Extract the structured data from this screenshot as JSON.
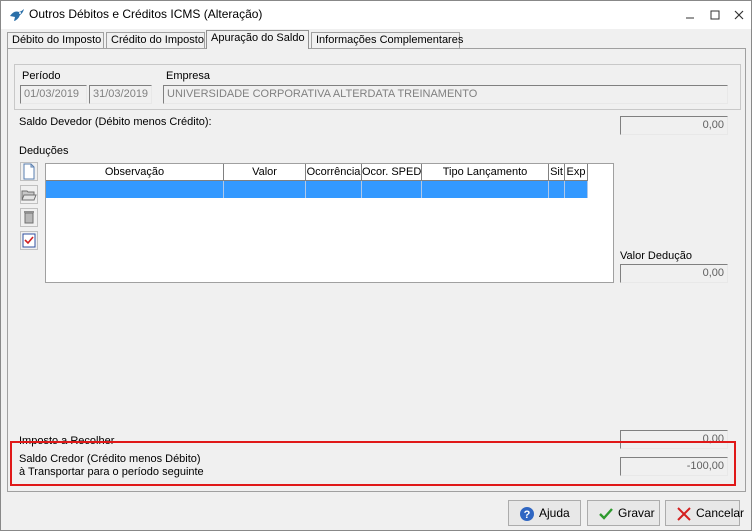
{
  "window": {
    "title": "Outros Débitos e Créditos ICMS (Alteração)",
    "minimize_icon": "minimize-icon",
    "maximize_icon": "maximize-icon",
    "close_icon": "close-icon"
  },
  "tabs": [
    {
      "label": "Débito do Imposto",
      "active": false
    },
    {
      "label": "Crédito do Imposto",
      "active": false
    },
    {
      "label": "Apuração do Saldo",
      "active": true
    },
    {
      "label": "Informações Complementares",
      "active": false
    }
  ],
  "periodo": {
    "label": "Período",
    "inicio": "01/03/2019",
    "fim": "31/03/2019"
  },
  "empresa": {
    "label": "Empresa",
    "value": "UNIVERSIDADE CORPORATIVA ALTERDATA TREINAMENTO"
  },
  "saldo_devedor": {
    "label": "Saldo Devedor (Débito menos Crédito):",
    "value": "0,00"
  },
  "deducoes": {
    "label": "Deduções",
    "columns": [
      "Observação",
      "Valor",
      "Ocorrência",
      "Ocor. SPED",
      "Tipo Lançamento",
      "Sit",
      "Exp"
    ],
    "toolbar_icons": [
      "new-document-icon",
      "open-folder-icon",
      "delete-icon",
      "checklist-icon"
    ]
  },
  "valor_deducao": {
    "label": "Valor Dedução",
    "value": "0,00"
  },
  "imposto_recolher": {
    "label": "Imposto a Recolher",
    "value": "0,00"
  },
  "saldo_credor": {
    "label_line1": "Saldo Credor (Crédito menos Débito)",
    "label_line2": "à Transportar para o período seguinte",
    "value": "-100,00"
  },
  "buttons": {
    "ajuda": "Ajuda",
    "gravar": "Gravar",
    "cancelar": "Cancelar"
  },
  "colors": {
    "selection": "#3399ff",
    "highlight_border": "#e01818"
  }
}
